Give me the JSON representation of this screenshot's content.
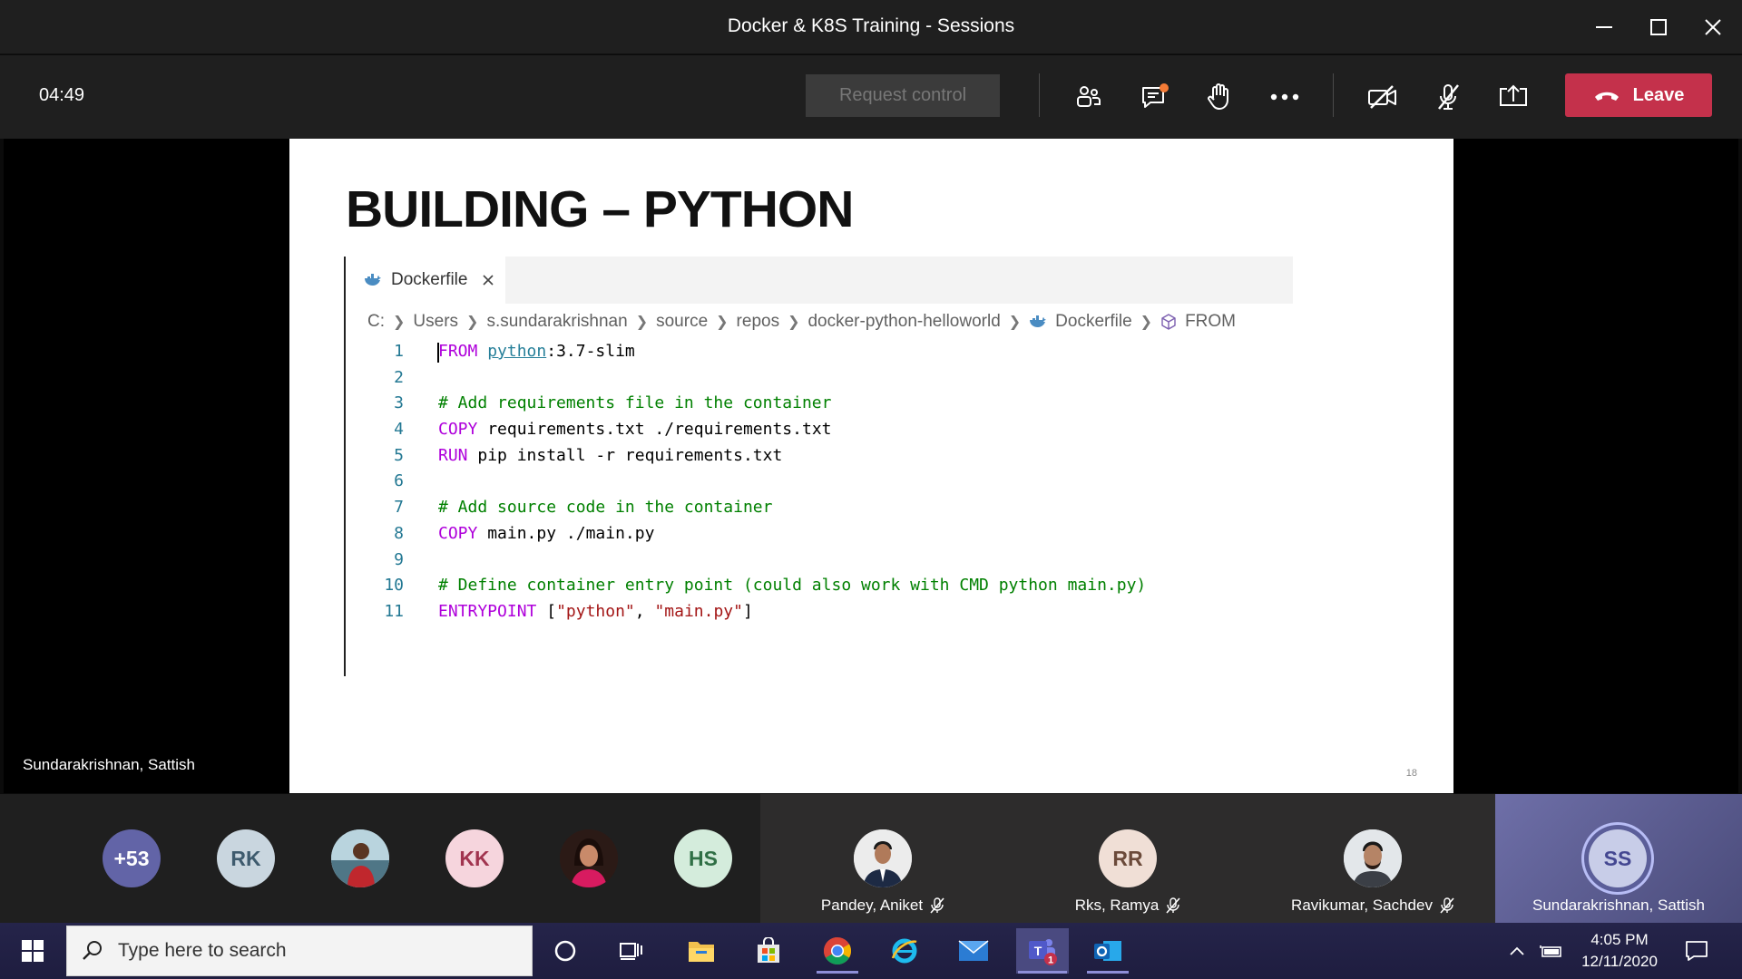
{
  "window": {
    "title": "Docker & K8S Training - Sessions"
  },
  "toolbar": {
    "timer": "04:49",
    "request_control_label": "Request control",
    "leave_label": "Leave",
    "icons": [
      "participants-icon",
      "chat-icon",
      "raise-hand-icon",
      "more-options-icon",
      "camera-off-icon",
      "mic-off-icon",
      "share-screen-icon"
    ],
    "chat_badge_color": "#f47b36",
    "leave_color": "#c4314b"
  },
  "stage": {
    "presenter_name": "Sundarakrishnan, Sattish"
  },
  "slide": {
    "title": "BUILDING – PYTHON",
    "page_number": "18"
  },
  "editor": {
    "tab_label": "Dockerfile",
    "breadcrumbs": [
      "C:",
      "Users",
      "s.sundarakrishnan",
      "source",
      "repos",
      "docker-python-helloworld",
      "Dockerfile",
      "FROM"
    ],
    "lines": [
      {
        "num": "1",
        "tokens": [
          {
            "t": "FROM",
            "k": "kw"
          },
          {
            "t": " ",
            "k": "plain"
          },
          {
            "t": "python",
            "k": "img"
          },
          {
            "t": ":3.7-slim",
            "k": "plain"
          }
        ]
      },
      {
        "num": "2",
        "tokens": []
      },
      {
        "num": "3",
        "tokens": [
          {
            "t": "# Add requirements file in the container",
            "k": "cmt"
          }
        ]
      },
      {
        "num": "4",
        "tokens": [
          {
            "t": "COPY",
            "k": "kw"
          },
          {
            "t": " requirements.txt ./requirements.txt",
            "k": "plain"
          }
        ]
      },
      {
        "num": "5",
        "tokens": [
          {
            "t": "RUN",
            "k": "kw"
          },
          {
            "t": " pip install -r requirements.txt",
            "k": "plain"
          }
        ]
      },
      {
        "num": "6",
        "tokens": []
      },
      {
        "num": "7",
        "tokens": [
          {
            "t": "# Add source code in the container",
            "k": "cmt"
          }
        ]
      },
      {
        "num": "8",
        "tokens": [
          {
            "t": "COPY",
            "k": "kw"
          },
          {
            "t": " main.py ./main.py",
            "k": "plain"
          }
        ]
      },
      {
        "num": "9",
        "tokens": []
      },
      {
        "num": "10",
        "tokens": [
          {
            "t": "# Define container entry point (could also work with CMD python main.py)",
            "k": "cmt"
          }
        ]
      },
      {
        "num": "11",
        "tokens": [
          {
            "t": "ENTRYPOINT",
            "k": "kw"
          },
          {
            "t": " [",
            "k": "plain"
          },
          {
            "t": "\"python\"",
            "k": "str"
          },
          {
            "t": ", ",
            "k": "plain"
          },
          {
            "t": "\"main.py\"",
            "k": "str"
          },
          {
            "t": "]",
            "k": "plain"
          }
        ]
      }
    ]
  },
  "participants": {
    "overflow_count": "+53",
    "avatars": [
      {
        "initials": "RK",
        "bg": "#c9d6df",
        "fg": "#3e5b6e"
      },
      {
        "initials": "",
        "bg": "#6f8a95",
        "fg": "#ffffff",
        "photo": "person-red-shirt"
      },
      {
        "initials": "KK",
        "bg": "#f6d5dd",
        "fg": "#a1344f"
      },
      {
        "initials": "",
        "bg": "#3a1f1a",
        "fg": "#ffffff",
        "photo": "person-woman"
      },
      {
        "initials": "HS",
        "bg": "#d4ecdc",
        "fg": "#2f6f45"
      }
    ],
    "tiles": [
      {
        "name": "Pandey, Aniket",
        "initials": "",
        "muted": true,
        "photo": "person-suit"
      },
      {
        "name": "Rks, Ramya",
        "initials": "RR",
        "muted": true,
        "bg": "#f0dfd6",
        "fg": "#6b4a3a"
      },
      {
        "name": "Ravikumar, Sachdev",
        "initials": "",
        "muted": true,
        "photo": "person-beard"
      },
      {
        "name": "Sundarakrishnan, Sattish",
        "initials": "SS",
        "muted": false,
        "bg": "#c8cde8",
        "fg": "#444791",
        "speaking": true
      }
    ]
  },
  "taskbar": {
    "search_placeholder": "Type here to search",
    "apps": [
      "cortana-icon",
      "task-view-icon",
      "file-explorer-icon",
      "store-icon",
      "chrome-icon",
      "edge-icon",
      "mail-icon",
      "teams-icon",
      "outlook-icon"
    ],
    "teams_badge": "1",
    "time": "4:05 PM",
    "date": "12/11/2020"
  }
}
